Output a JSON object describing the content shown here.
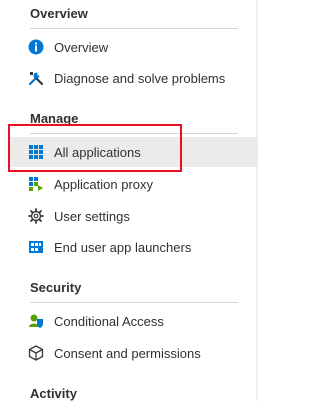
{
  "sidebar": {
    "sections": [
      {
        "header": "Overview",
        "items": [
          {
            "label": "Overview",
            "icon": "info-icon"
          },
          {
            "label": "Diagnose and solve problems",
            "icon": "tools-icon"
          }
        ]
      },
      {
        "header": "Manage",
        "items": [
          {
            "label": "All applications",
            "icon": "apps-grid-icon",
            "selected": true
          },
          {
            "label": "Application proxy",
            "icon": "app-proxy-icon"
          },
          {
            "label": "User settings",
            "icon": "gear-icon"
          },
          {
            "label": "End user app launchers",
            "icon": "app-launcher-icon"
          }
        ]
      },
      {
        "header": "Security",
        "items": [
          {
            "label": "Conditional Access",
            "icon": "conditional-access-icon"
          },
          {
            "label": "Consent and permissions",
            "icon": "cube-icon"
          }
        ]
      },
      {
        "header": "Activity",
        "items": []
      }
    ]
  },
  "colors": {
    "accent_blue": "#0078d4",
    "highlight_red": "#e81123",
    "selected_bg": "#edebe9",
    "text": "#323130"
  }
}
